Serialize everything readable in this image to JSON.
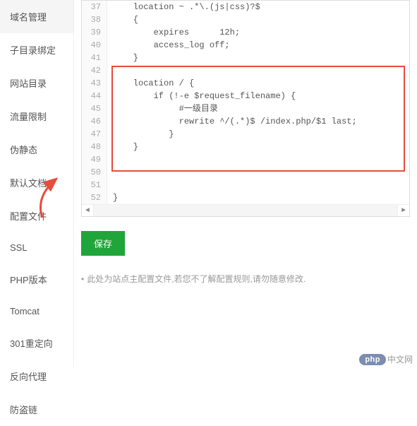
{
  "sidebar": {
    "items": [
      {
        "label": "域名管理"
      },
      {
        "label": "子目录绑定"
      },
      {
        "label": "网站目录"
      },
      {
        "label": "流量限制"
      },
      {
        "label": "伪静态"
      },
      {
        "label": "默认文档"
      },
      {
        "label": "配置文件"
      },
      {
        "label": "SSL"
      },
      {
        "label": "PHP版本"
      },
      {
        "label": "Tomcat"
      },
      {
        "label": "301重定向"
      },
      {
        "label": "反向代理"
      },
      {
        "label": "防盗链"
      }
    ]
  },
  "code": {
    "lines": [
      {
        "num": "37",
        "text": "    location ~ .*\\.(js|css)?$"
      },
      {
        "num": "38",
        "text": "    {"
      },
      {
        "num": "39",
        "text": "        expires      12h;"
      },
      {
        "num": "40",
        "text": "        access_log off;"
      },
      {
        "num": "41",
        "text": "    }"
      },
      {
        "num": "42",
        "text": ""
      },
      {
        "num": "43",
        "text": "    location / {"
      },
      {
        "num": "44",
        "text": "        if (!-e $request_filename) {"
      },
      {
        "num": "45",
        "text": "             #一级目录"
      },
      {
        "num": "46",
        "text": "             rewrite ^/(.*)$ /index.php/$1 last;"
      },
      {
        "num": "47",
        "text": "           }"
      },
      {
        "num": "48",
        "text": "    }"
      },
      {
        "num": "49",
        "text": ""
      },
      {
        "num": "50",
        "text": ""
      },
      {
        "num": "51",
        "text": ""
      },
      {
        "num": "52",
        "text": "}"
      }
    ]
  },
  "actions": {
    "save_label": "保存"
  },
  "note": {
    "bullet": "•",
    "text": "此处为站点主配置文件,若您不了解配置规则,请勿随意修改."
  },
  "watermark": {
    "badge": "php",
    "text": "中文网"
  },
  "scroll": {
    "left": "◄",
    "right": "►"
  }
}
